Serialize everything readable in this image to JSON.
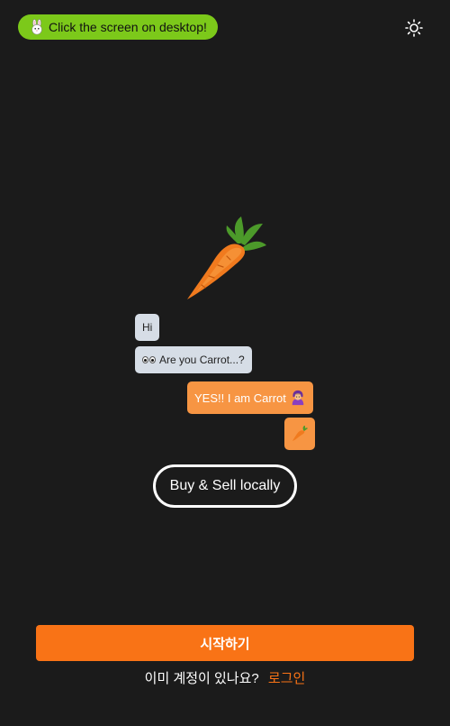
{
  "hint": {
    "text": "Click the screen on desktop!",
    "icon": "rabbit-icon",
    "color": "#7cc91a"
  },
  "theme_toggle": {
    "icon": "sun-icon"
  },
  "hero": {
    "icon": "carrot-icon"
  },
  "chat": {
    "messages": [
      {
        "side": "left",
        "text": "Hi"
      },
      {
        "side": "left",
        "text": "Are you Carrot...?",
        "prefix_icon": "eyes-icon"
      },
      {
        "side": "right",
        "text": "YES!! I am Carrot",
        "suffix_icon": "person-gesturing-icon"
      },
      {
        "side": "right",
        "text": "",
        "icon": "carrot-icon"
      }
    ]
  },
  "tagline": "Buy & Sell locally",
  "start_button": {
    "label": "시작하기",
    "color": "#f97316"
  },
  "login": {
    "question": "이미 계정이 있나요?",
    "link_label": "로그인"
  }
}
